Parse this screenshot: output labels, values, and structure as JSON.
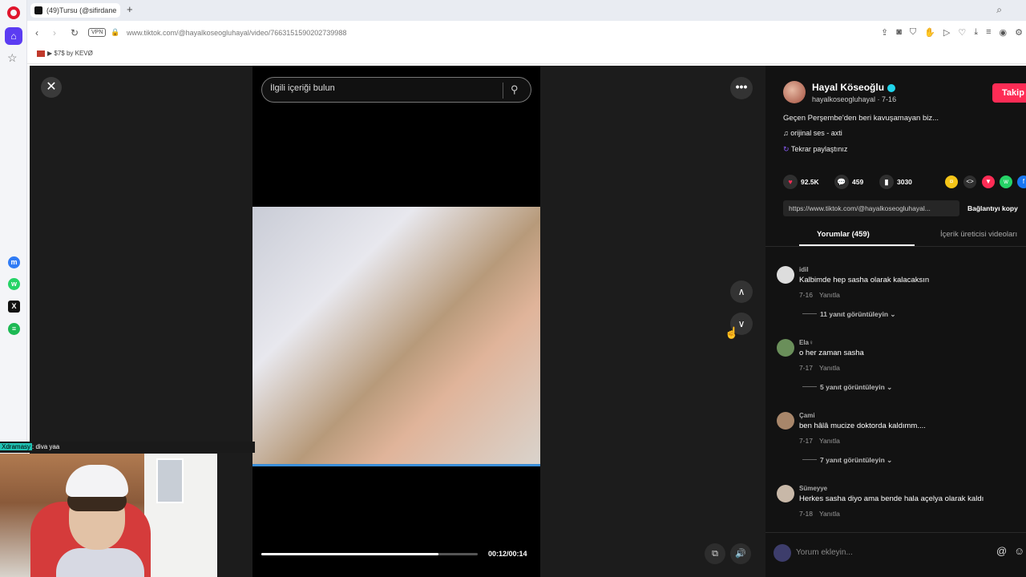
{
  "browser": {
    "tab_title": "(49)Tursu (@sifirdane",
    "url": "www.tiktok.com/@hayalkoseogluhayal/video/7663151590202739988",
    "vpn_label": "VPN",
    "bookmark": "▶ $7$ by KEVØ"
  },
  "viewer": {
    "search_placeholder": "İlgili içeriği bulun",
    "time": "00:12/00:14",
    "progress_fraction": 0.82
  },
  "panel": {
    "author_name": "Hayal Köseoğlu",
    "author_handle": "hayalkoseogluhayal · 7-16",
    "follow_label": "Takip",
    "description": "Geçen Perşembe'den beri kavuşamayan biz...",
    "sound": "orijinal ses - axti",
    "repost": "Tekrar paylaştınız",
    "likes": "92.5K",
    "comments_count": "459",
    "saves": "3030",
    "link": "https://www.tiktok.com/@hayalkoseogluhayal...",
    "copy_link": "Bağlantıyı kopy",
    "tab_comments": "Yorumlar (459)",
    "tab_creator": "İçerik üreticisi videoları",
    "comment_placeholder": "Yorum ekleyin..."
  },
  "comments": [
    {
      "user": "idil",
      "text": "Kalbimde hep sasha olarak kalacaksın",
      "date": "7-16",
      "reply": "Yanıtla",
      "view": "11 yanıt görüntüleyin ⌄"
    },
    {
      "user": "Ela♀",
      "text": "o her zaman sasha",
      "date": "7-17",
      "reply": "Yanıtla",
      "view": "5 yanıt görüntüleyin ⌄"
    },
    {
      "user": "Çami",
      "text": "ben hâlâ mucize doktorda kaldımm....",
      "date": "7-17",
      "reply": "Yanıtla",
      "view": "7 yanıt görüntüleyin ⌄"
    },
    {
      "user": "Sümeyye",
      "text": "Herkes sasha diyo ama bende hala açelya olarak kaldı",
      "date": "7-18",
      "reply": "Yanıtla",
      "view": ""
    }
  ],
  "stream_overlay": {
    "chat_user": "Xdramasy",
    "chat_text": ": diva yaa"
  },
  "colors": {
    "accent": "#fe2c55",
    "verified": "#20d5ec",
    "opera_red": "#e0152c"
  }
}
